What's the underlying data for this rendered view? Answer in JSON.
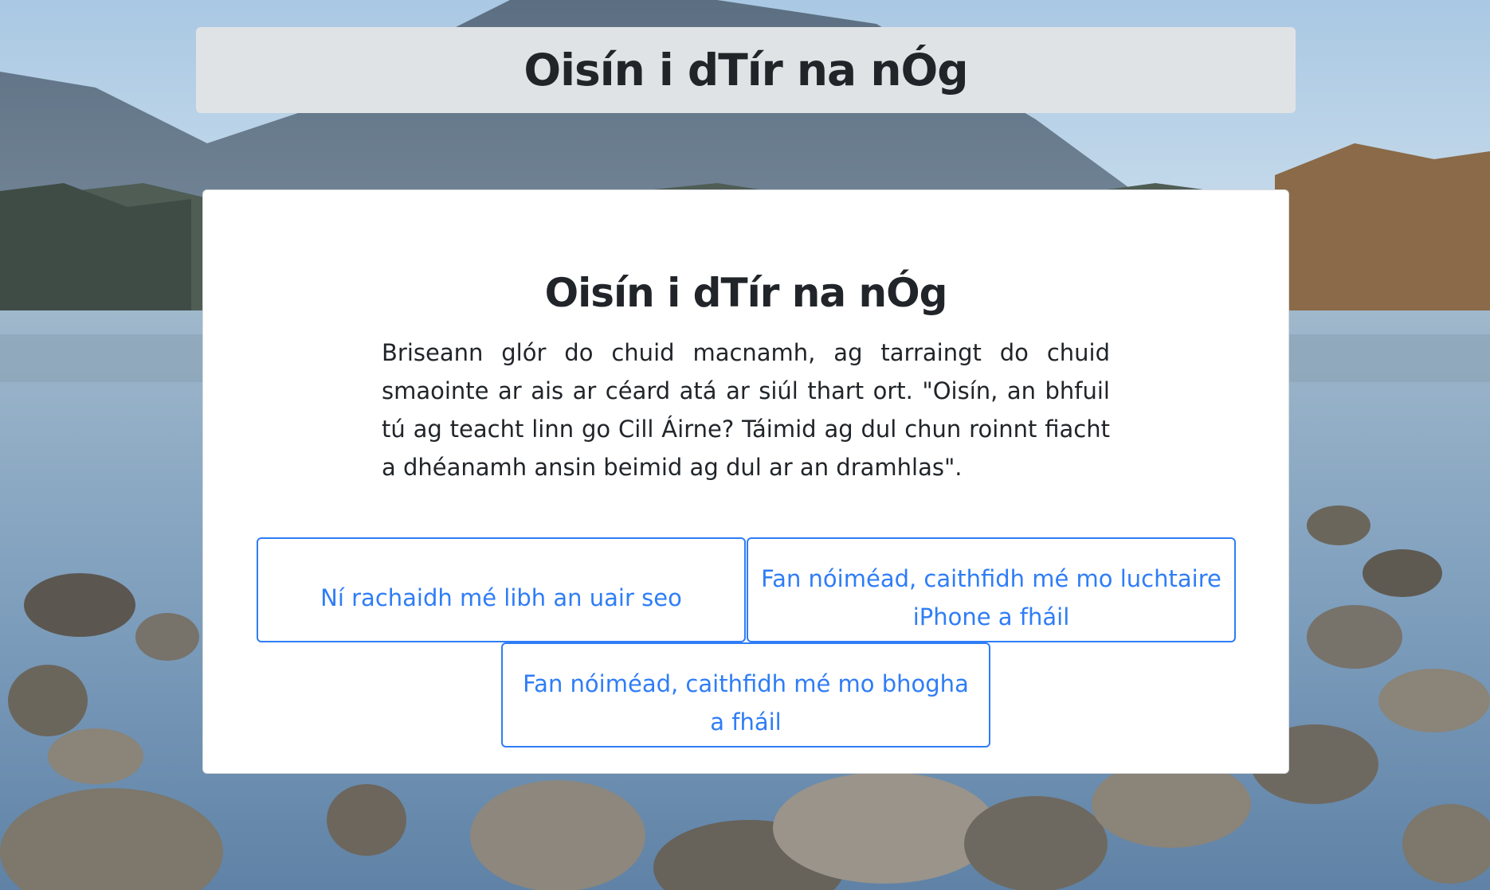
{
  "header": {
    "title": "Oisín i dTír na nÓg"
  },
  "card": {
    "title": "Oisín i dTír na nÓg",
    "text": "Briseann glór do chuid macnamh, ag tarraingt do chuid smaointe ar ais ar céard atá ar siúl thart ort. \"Oisín, an bhfuil tú ag teacht linn go Cill Áirne? Táimid ag dul chun roinnt fiacht a dhéanamh ansin beimid ag dul ar an dramhlas\"."
  },
  "choices": [
    {
      "label": "Ní rachaidh mé libh an uair seo"
    },
    {
      "label": "Fan nóiméad, caithfidh mé mo luchtaire iPhone a fháil"
    },
    {
      "label": "Fan nóiméad, caithfidh mé mo bhogha a fháil"
    }
  ],
  "colors": {
    "accent": "#2f7df6",
    "header_bg": "#e0e3e6",
    "text": "#212529"
  },
  "background": "lake-mountain-rocks-photo"
}
